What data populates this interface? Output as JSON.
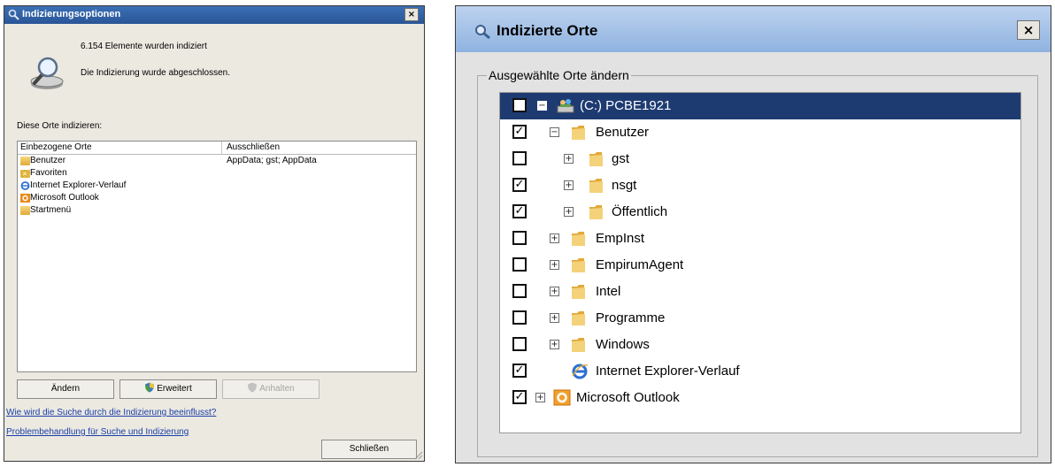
{
  "left_dialog": {
    "title": "Indizierungsoptionen",
    "close_glyph": "×",
    "status_count": "6.154 Elemente wurden indiziert",
    "status_done": "Die Indizierung wurde abgeschlossen.",
    "index_label": "Diese Orte indizieren:",
    "columns": [
      "Einbezogene Orte",
      "Ausschließen"
    ],
    "rows": [
      {
        "name": "Benutzer",
        "exclude": "AppData; gst; AppData",
        "icon": "folder-icon"
      },
      {
        "name": "Favoriten",
        "exclude": "",
        "icon": "favorites-folder-icon"
      },
      {
        "name": "Internet Explorer-Verlauf",
        "exclude": "",
        "icon": "ie-icon"
      },
      {
        "name": "Microsoft Outlook",
        "exclude": "",
        "icon": "outlook-icon"
      },
      {
        "name": "Startmenü",
        "exclude": "",
        "icon": "folder-icon"
      }
    ],
    "buttons": {
      "change": "Ändern",
      "advanced": "Erweitert",
      "pause": "Anhalten",
      "close": "Schließen"
    },
    "links": {
      "help": "Wie wird die Suche durch die Indizierung beeinflusst?",
      "troubleshoot": "Problembehandlung für Suche und Indizierung"
    }
  },
  "right_dialog": {
    "title": "Indizierte Orte",
    "close_glyph": "×",
    "group_label": "Ausgewählte Orte ändern",
    "tree": [
      {
        "label": "(C:) PCBE1921",
        "checked": false,
        "expander": "−",
        "level": 0,
        "icon": "drive-icon",
        "selected": true
      },
      {
        "label": "Benutzer",
        "checked": true,
        "expander": "−",
        "level": 1,
        "icon": "folder-icon"
      },
      {
        "label": "gst",
        "checked": false,
        "expander": "+",
        "level": 2,
        "icon": "folder-icon"
      },
      {
        "label": "nsgt",
        "checked": true,
        "expander": "+",
        "level": 2,
        "icon": "folder-icon"
      },
      {
        "label": "Öffentlich",
        "checked": true,
        "expander": "+",
        "level": 2,
        "icon": "folder-icon"
      },
      {
        "label": "EmpInst",
        "checked": false,
        "expander": "+",
        "level": 1,
        "icon": "folder-icon"
      },
      {
        "label": "EmpirumAgent",
        "checked": false,
        "expander": "+",
        "level": 1,
        "icon": "folder-icon"
      },
      {
        "label": "Intel",
        "checked": false,
        "expander": "+",
        "level": 1,
        "icon": "folder-icon"
      },
      {
        "label": "Programme",
        "checked": false,
        "expander": "+",
        "level": 1,
        "icon": "folder-icon"
      },
      {
        "label": "Windows",
        "checked": false,
        "expander": "+",
        "level": 1,
        "icon": "folder-icon"
      },
      {
        "label": "Internet Explorer-Verlauf",
        "checked": true,
        "expander": "",
        "level": 1,
        "icon": "ie-icon"
      },
      {
        "label": "Microsoft Outlook",
        "checked": true,
        "expander": "+",
        "level": 0,
        "icon": "outlook-icon"
      }
    ]
  },
  "colors": {
    "left_titlebar": "#2f5fa5",
    "right_titlebar": "#a9c4e9",
    "selection": "#1e3b71",
    "link": "#1a3fa8"
  }
}
